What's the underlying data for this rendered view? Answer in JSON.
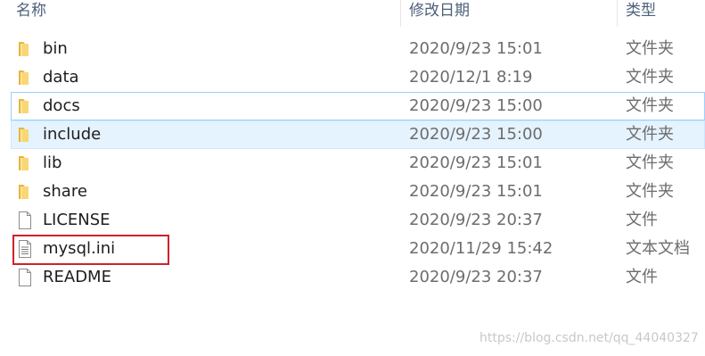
{
  "columns": {
    "name": "名称",
    "date_modified": "修改日期",
    "type": "类型"
  },
  "files": [
    {
      "name": "bin",
      "date": "2020/9/23 15:01",
      "type": "文件夹",
      "icon": "folder-icon"
    },
    {
      "name": "data",
      "date": "2020/12/1 8:19",
      "type": "文件夹",
      "icon": "folder-icon"
    },
    {
      "name": "docs",
      "date": "2020/9/23 15:00",
      "type": "文件夹",
      "icon": "folder-icon"
    },
    {
      "name": "include",
      "date": "2020/9/23 15:00",
      "type": "文件夹",
      "icon": "folder-icon"
    },
    {
      "name": "lib",
      "date": "2020/9/23 15:01",
      "type": "文件夹",
      "icon": "folder-icon"
    },
    {
      "name": "share",
      "date": "2020/9/23 15:01",
      "type": "文件夹",
      "icon": "folder-icon"
    },
    {
      "name": "LICENSE",
      "date": "2020/9/23 20:37",
      "type": "文件",
      "icon": "blank-file-icon"
    },
    {
      "name": "mysql.ini",
      "date": "2020/11/29 15:42",
      "type": "文本文档",
      "icon": "text-document-icon"
    },
    {
      "name": "README",
      "date": "2020/9/23 20:37",
      "type": "文件",
      "icon": "blank-file-icon"
    }
  ],
  "watermark": "https://blog.csdn.net/qq_44040327",
  "colors": {
    "folder": "#f8d775",
    "folder_dark": "#e8b43c",
    "hover_bg": "#e5f3ff",
    "highlight": "#d0212a"
  }
}
